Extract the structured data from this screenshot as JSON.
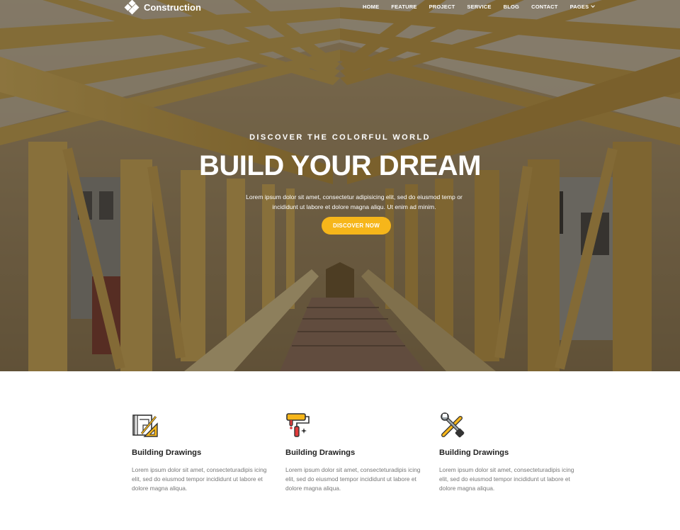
{
  "brand": {
    "name": "Construction",
    "logo_icon": "diamond-grid-logo"
  },
  "nav": {
    "items": [
      {
        "label": "HOME"
      },
      {
        "label": "FEATURE"
      },
      {
        "label": "PROJECT"
      },
      {
        "label": "SERVICE"
      },
      {
        "label": "BLOG"
      },
      {
        "label": "CONTACT"
      },
      {
        "label": "PAGES",
        "icon": "chevron-down-icon"
      }
    ]
  },
  "hero": {
    "kicker": "DISCOVER THE COLORFUL WORLD",
    "title": "BUILD YOUR DREAM",
    "text": "Lorem ipsum dolor sit amet, consectetur adipisicing elit, sed do eiusmod temp or incididunt ut labore et dolore magna aliqu. Ut enim ad minim.",
    "cta_label": "DISCOVER NOW"
  },
  "features": [
    {
      "icon": "blueprint-drawing-icon",
      "title": "Building Drawings",
      "text": "Lorem ipsum dolor sit amet, consecteturadipis icing elit, sed do eiusmod tempor incididunt ut labore et dolore magna aliqua."
    },
    {
      "icon": "paint-roller-icon",
      "title": "Building Drawings",
      "text": "Lorem ipsum dolor sit amet, consecteturadipis icing elit, sed do eiusmod tempor incididunt ut labore et dolore magna aliqua."
    },
    {
      "icon": "wrench-screwdriver-icon",
      "title": "Building Drawings",
      "text": "Lorem ipsum dolor sit amet, consecteturadipis icing elit, sed do eiusmod tempor incididunt ut labore et dolore magna aliqua."
    }
  ],
  "colors": {
    "accent": "#f6b61a",
    "timber": "#c9a552",
    "text_dark": "#222222",
    "text_muted": "#777777"
  }
}
